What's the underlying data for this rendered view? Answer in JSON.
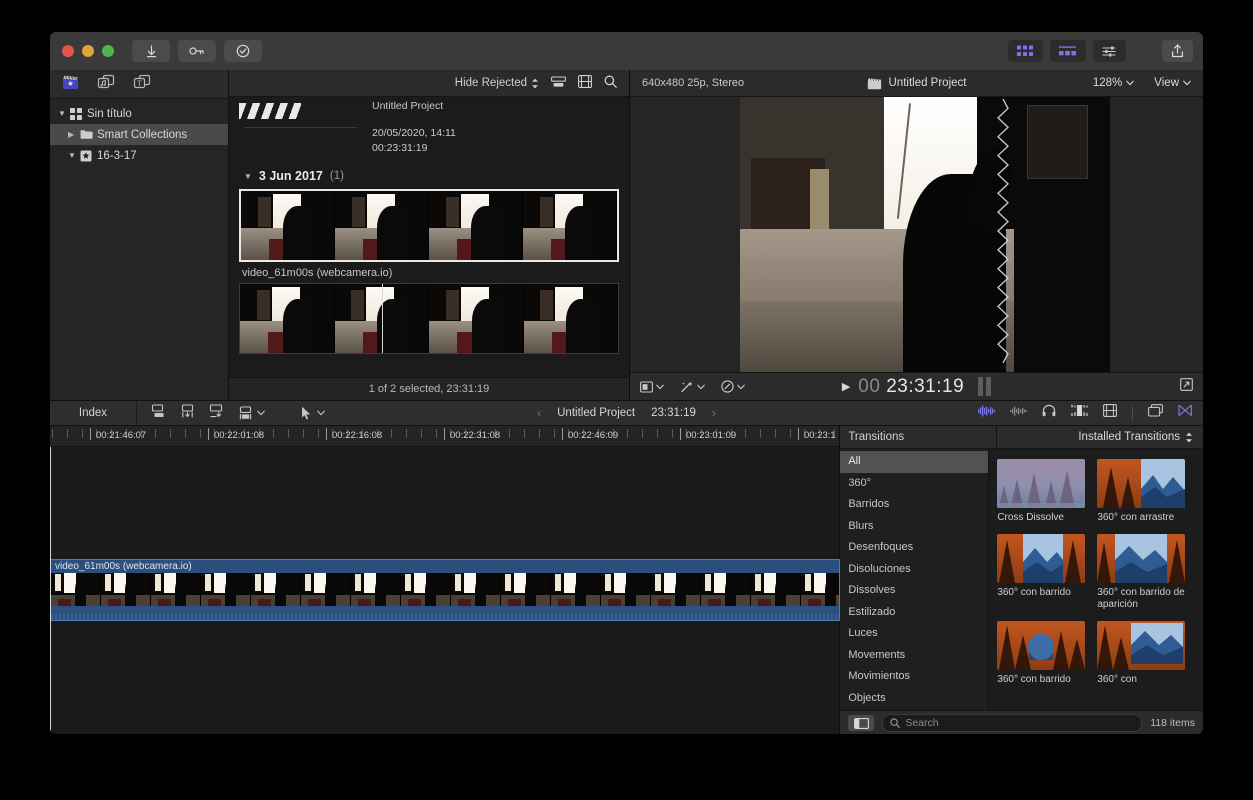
{
  "window": {
    "titlebar": {
      "buttons": [
        "close",
        "minimize",
        "zoom"
      ],
      "import_label": "import-icon",
      "keyword_label": "keyword-icon",
      "rate_label": "rate-icon",
      "right_buttons": [
        "browser-toggle",
        "timeline-toggle",
        "inspector-toggle",
        "share-button"
      ]
    }
  },
  "sidebar": {
    "tabs": [
      "libraries-icon",
      "photos-audio-icon",
      "titles-generators-icon"
    ],
    "items": [
      {
        "label": "Sin título",
        "icon": "library-icon",
        "expanded": true,
        "selected": false,
        "indent": 0
      },
      {
        "label": "Smart Collections",
        "icon": "folder-icon",
        "expanded": false,
        "selected": true,
        "indent": 1
      },
      {
        "label": "16-3-17",
        "icon": "event-icon",
        "expanded": true,
        "selected": false,
        "indent": 1
      }
    ]
  },
  "browser": {
    "hide_rejected": "Hide Rejected",
    "icons": [
      "filmstrip-view-icon",
      "list-view-icon",
      "search-icon"
    ],
    "project_clip": {
      "title": "Untitled Project",
      "date": "20/05/2020, 14:11",
      "duration": "00:23:31:19"
    },
    "date_group": {
      "label": "3 Jun 2017",
      "count": "(1)"
    },
    "clips": [
      {
        "name": "video_61m00s (webcamera.io)",
        "selected": true
      },
      {
        "name": "",
        "selected": false
      }
    ],
    "status": "1 of 2 selected, 23:31:19"
  },
  "viewer": {
    "format": "640x480 25p, Stereo",
    "project_name": "Untitled Project",
    "zoom": "128%",
    "view_menu": "View",
    "controls": [
      "viewer-display-options",
      "enhancements",
      "retime"
    ],
    "timecode_prefix": "00",
    "timecode": "23:31:19",
    "fullscreen": "fullscreen-icon"
  },
  "timeline_toolbar": {
    "index_label": "Index",
    "tools": [
      "append-icon",
      "insert-icon",
      "connect-icon",
      "overwrite-icon",
      "select-tool-icon"
    ],
    "project_name": "Untitled Project",
    "project_duration": "23:31:19",
    "right_tools": [
      "audio-meters-icon",
      "waveform-icon",
      "headphones-icon",
      "skimming-icon",
      "clip-appearance-icon",
      "window-icon",
      "scissors-icon"
    ]
  },
  "timeline": {
    "ruler_labels": [
      "00:21:46:07",
      "00:22:01:08",
      "00:22:16:08",
      "00:22:31:08",
      "00:22:46:09",
      "00:23:01:09",
      "00:23:1"
    ],
    "clip": {
      "name": "video_61m00s (webcamera.io)"
    }
  },
  "transitions": {
    "panel_title": "Transitions",
    "installed_label": "Installed Transitions",
    "categories": [
      {
        "label": "All",
        "selected": true
      },
      {
        "label": "360°",
        "selected": false
      },
      {
        "label": "Barridos",
        "selected": false
      },
      {
        "label": "Blurs",
        "selected": false
      },
      {
        "label": "Desenfoques",
        "selected": false
      },
      {
        "label": "Disoluciones",
        "selected": false
      },
      {
        "label": "Dissolves",
        "selected": false
      },
      {
        "label": "Estilizado",
        "selected": false
      },
      {
        "label": "Luces",
        "selected": false
      },
      {
        "label": "Movements",
        "selected": false
      },
      {
        "label": "Movimientos",
        "selected": false
      },
      {
        "label": "Objects",
        "selected": false
      }
    ],
    "items": [
      {
        "label": "Cross Dissolve",
        "style": "dissolve"
      },
      {
        "label": "360° con arrastre",
        "style": "split"
      },
      {
        "label": "360° con barrido",
        "style": "split-center"
      },
      {
        "label": "360° con barrido de aparición",
        "style": "split-wide"
      },
      {
        "label": "360° con barrido",
        "style": "circle"
      },
      {
        "label": "360° con",
        "style": "inset"
      }
    ],
    "search_placeholder": "Search",
    "item_count": "118 items"
  }
}
